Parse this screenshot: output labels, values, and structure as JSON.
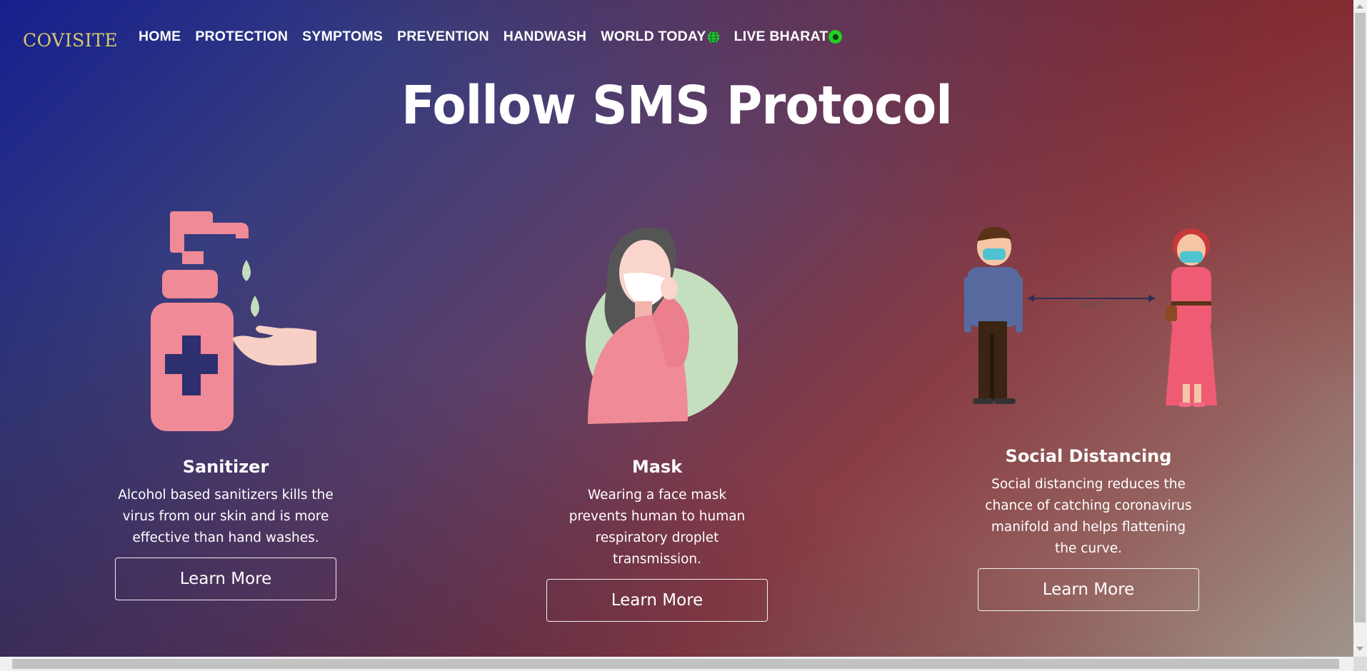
{
  "brand": "COVISITE",
  "nav": {
    "items": [
      "HOME",
      "PROTECTION",
      "SYMPTOMS",
      "PREVENTION",
      "HANDWASH",
      "WORLD TODAY",
      "LIVE BHARAT"
    ]
  },
  "headline": "Follow SMS Protocol",
  "cards": [
    {
      "title": "Sanitizer",
      "text": "Alcohol based sanitizers kills the virus from our skin and is more effective than hand washes.",
      "button": "Learn More",
      "icon": "sanitizer-illustration"
    },
    {
      "title": "Mask",
      "text": "Wearing a face mask prevents human to human respiratory droplet transmission.",
      "button": "Learn More",
      "icon": "mask-illustration"
    },
    {
      "title": "Social Distancing",
      "text": "Social distancing reduces the chance of catching coronavirus manifold and helps flattening the curve.",
      "button": "Learn More",
      "icon": "social-distancing-illustration"
    }
  ],
  "distance_label_top": "2m",
  "distance_label_bottom": "6 FEET",
  "colors": {
    "brand": "#d8c96b",
    "live_dot": "#20d020",
    "illustration_pink": "#f08a96",
    "illustration_green": "#c3dfbd"
  }
}
